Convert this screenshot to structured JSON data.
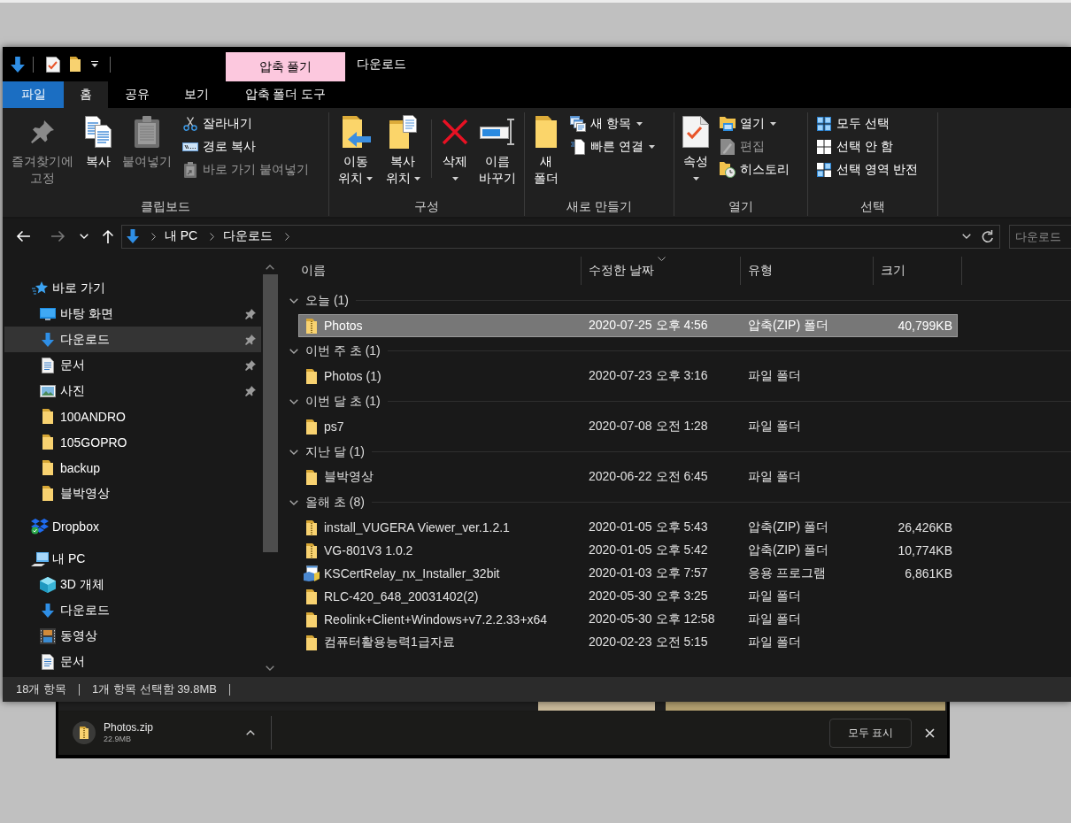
{
  "title_bar": {
    "context_tab": "압축 풀기",
    "title": "다운로드"
  },
  "tabs": [
    {
      "label": "파일",
      "kind": "file",
      "selected": false
    },
    {
      "label": "홈",
      "kind": "tab",
      "selected": true
    },
    {
      "label": "공유",
      "kind": "tab",
      "selected": false
    },
    {
      "label": "보기",
      "kind": "tab",
      "selected": false
    },
    {
      "label": "압축 폴더 도구",
      "kind": "tab",
      "selected": false
    }
  ],
  "ribbon": {
    "groups": [
      {
        "label": "클립보드",
        "items": [
          {
            "kind": "large",
            "label": "즐겨찾기에 고정",
            "dropdown": false,
            "disabled": true
          },
          {
            "kind": "large",
            "label": "복사",
            "dropdown": false,
            "disabled": false
          },
          {
            "kind": "large",
            "label": "붙여넣기",
            "dropdown": false,
            "disabled": true
          },
          {
            "kind": "small",
            "label": "잘라내기",
            "dropdown": false,
            "disabled": false
          },
          {
            "kind": "small",
            "label": "경로 복사",
            "dropdown": false,
            "disabled": false
          },
          {
            "kind": "small",
            "label": "바로 가기 붙여넣기",
            "dropdown": false,
            "disabled": true
          }
        ]
      },
      {
        "label": "구성",
        "items": [
          {
            "kind": "large",
            "label": "이동 위치",
            "dropdown": true,
            "disabled": false
          },
          {
            "kind": "large",
            "label": "복사 위치",
            "dropdown": true,
            "disabled": false
          },
          {
            "kind": "separator"
          },
          {
            "kind": "large",
            "label": "삭제",
            "dropdown": true,
            "disabled": false
          },
          {
            "kind": "large",
            "label": "이름 바꾸기",
            "dropdown": false,
            "disabled": false
          }
        ]
      },
      {
        "label": "새로 만들기",
        "items": [
          {
            "kind": "large",
            "label": "새 폴더",
            "dropdown": false,
            "disabled": false
          },
          {
            "kind": "small",
            "label": "새 항목",
            "dropdown": true,
            "disabled": false
          },
          {
            "kind": "small",
            "label": "빠른 연결",
            "dropdown": true,
            "disabled": false
          }
        ]
      },
      {
        "label": "열기",
        "items": [
          {
            "kind": "large",
            "label": "속성",
            "dropdown": true,
            "disabled": false
          },
          {
            "kind": "small",
            "label": "열기",
            "dropdown": true,
            "disabled": false
          },
          {
            "kind": "small",
            "label": "편집",
            "dropdown": false,
            "disabled": true
          },
          {
            "kind": "small",
            "label": "히스토리",
            "dropdown": false,
            "disabled": false
          }
        ]
      },
      {
        "label": "선택",
        "items": [
          {
            "kind": "small",
            "label": "모두 선택",
            "dropdown": false,
            "disabled": false
          },
          {
            "kind": "small",
            "label": "선택 안 함",
            "dropdown": false,
            "disabled": false
          },
          {
            "kind": "small",
            "label": "선택 영역 반전",
            "dropdown": false,
            "disabled": false
          }
        ]
      }
    ]
  },
  "navigation": [
    {
      "kind": "back",
      "disabled": false
    },
    {
      "kind": "forward",
      "disabled": true
    },
    {
      "kind": "recent",
      "disabled": false
    },
    {
      "kind": "up",
      "disabled": false
    }
  ],
  "address_bar": {
    "path": [
      "내 PC",
      "다운로드"
    ]
  },
  "search": {
    "placeholder": "다운로드"
  },
  "sidebar": {
    "items": [
      {
        "kind": "quickaccess",
        "label": "바로 가기",
        "selected": false,
        "children": [
          {
            "kind": "desktop",
            "label": "바탕 화면",
            "pinned": true,
            "selected": false
          },
          {
            "kind": "downloads",
            "label": "다운로드",
            "pinned": true,
            "selected": true
          },
          {
            "kind": "documents",
            "label": "문서",
            "pinned": true,
            "selected": false
          },
          {
            "kind": "pictures",
            "label": "사진",
            "pinned": true,
            "selected": false
          },
          {
            "kind": "folder",
            "label": "100ANDRO",
            "pinned": false,
            "selected": false
          },
          {
            "kind": "folder",
            "label": "105GOPRO",
            "pinned": false,
            "selected": false
          },
          {
            "kind": "folder",
            "label": "backup",
            "pinned": false,
            "selected": false
          },
          {
            "kind": "folder",
            "label": "블박영상",
            "pinned": false,
            "selected": false
          }
        ]
      },
      {
        "kind": "cloud",
        "label": "Dropbox",
        "selected": false
      },
      {
        "kind": "computer",
        "label": "내 PC",
        "selected": false,
        "children": [
          {
            "kind": "objects",
            "label": "3D 개체",
            "pinned": false,
            "selected": false
          },
          {
            "kind": "downloads",
            "label": "다운로드",
            "pinned": false,
            "selected": false
          },
          {
            "kind": "videos",
            "label": "동영상",
            "pinned": false,
            "selected": false
          },
          {
            "kind": "documents",
            "label": "문서",
            "pinned": false,
            "selected": false
          }
        ]
      }
    ]
  },
  "file_list": {
    "columns": [
      {
        "label": "이름",
        "sorted": false
      },
      {
        "label": "수정한 날짜",
        "sorted": true
      },
      {
        "label": "유형",
        "sorted": false
      },
      {
        "label": "크기",
        "sorted": false
      }
    ],
    "groups": [
      {
        "label": "오늘 (1)",
        "expanded": true,
        "rows": [
          {
            "kind": "zip",
            "name": "Photos",
            "date": "2020-07-25 오후 4:56",
            "type": "압축(ZIP) 폴더",
            "size": "40,799KB",
            "selected": true
          }
        ]
      },
      {
        "label": "이번 주 초 (1)",
        "expanded": true,
        "rows": [
          {
            "kind": "folder",
            "name": "Photos (1)",
            "date": "2020-07-23 오후 3:16",
            "type": "파일 폴더",
            "selected": false
          }
        ]
      },
      {
        "label": "이번 달 초 (1)",
        "expanded": true,
        "rows": [
          {
            "kind": "folder",
            "name": "ps7",
            "date": "2020-07-08 오전 1:28",
            "type": "파일 폴더",
            "selected": false
          }
        ]
      },
      {
        "label": "지난 달 (1)",
        "expanded": true,
        "rows": [
          {
            "kind": "folder",
            "name": "블박영상",
            "date": "2020-06-22 오전 6:45",
            "type": "파일 폴더",
            "selected": false
          }
        ]
      },
      {
        "label": "올해 초 (8)",
        "expanded": true,
        "rows": [
          {
            "kind": "zip",
            "name": "install_VUGERA Viewer_ver.1.2.1",
            "date": "2020-01-05 오후 5:43",
            "type": "압축(ZIP) 폴더",
            "size": "26,426KB",
            "selected": false
          },
          {
            "kind": "zip",
            "name": "VG-801V3 1.0.2",
            "date": "2020-01-05 오후 5:42",
            "type": "압축(ZIP) 폴더",
            "size": "10,774KB",
            "selected": false
          },
          {
            "kind": "program",
            "name": "KSCertRelay_nx_Installer_32bit",
            "date": "2020-01-03 오후 7:57",
            "type": "응용 프로그램",
            "size": "6,861KB",
            "selected": false
          },
          {
            "kind": "folder",
            "name": "RLC-420_648_20031402(2)",
            "date": "2020-05-30 오후 3:25",
            "type": "파일 폴더",
            "selected": false
          },
          {
            "kind": "folder",
            "name": "Reolink+Client+Windows+v7.2.2.33+x64",
            "date": "2020-05-30 오후 12:58",
            "type": "파일 폴더",
            "selected": false
          },
          {
            "kind": "folder",
            "name": "컴퓨터활용능력1급자료",
            "date": "2020-02-23 오전 5:15",
            "type": "파일 폴더",
            "selected": false
          }
        ]
      }
    ]
  },
  "status_bar": {
    "items": [
      "18개 항목",
      "1개 항목 선택함 39.8MB"
    ]
  },
  "download_bar": {
    "file_name": "Photos.zip",
    "file_size": "22.9MB",
    "show_all_button": "모두 표시"
  }
}
